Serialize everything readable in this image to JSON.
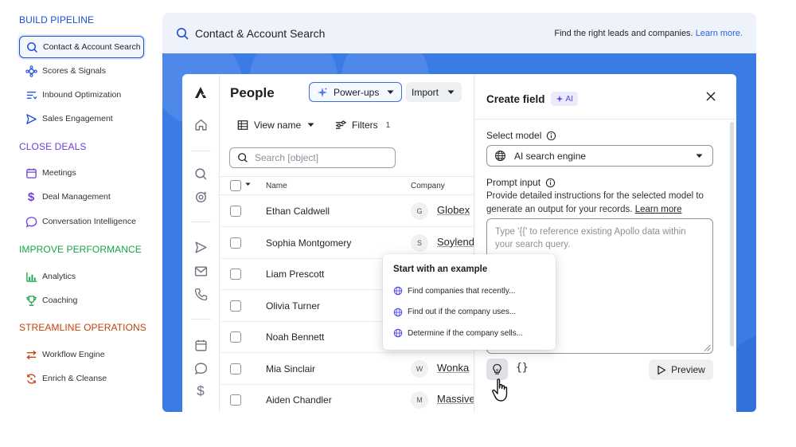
{
  "sidebar": {
    "sections": [
      {
        "title": "BUILD PIPELINE",
        "color": "#1d4ed8",
        "items": [
          {
            "label": "Contact & Account Search",
            "icon": "search-icon",
            "active": true
          },
          {
            "label": "Scores & Signals",
            "icon": "signals-icon"
          },
          {
            "label": "Inbound Optimization",
            "icon": "inbound-icon"
          },
          {
            "label": "Sales Engagement",
            "icon": "send-icon"
          }
        ]
      },
      {
        "title": "CLOSE DEALS",
        "color": "#6d3fd6",
        "items": [
          {
            "label": "Meetings",
            "icon": "calendar-icon"
          },
          {
            "label": "Deal Management",
            "icon": "dollar-icon"
          },
          {
            "label": "Conversation Intelligence",
            "icon": "chat-icon"
          }
        ]
      },
      {
        "title": "IMPROVE PERFORMANCE",
        "color": "#16a34a",
        "items": [
          {
            "label": "Analytics",
            "icon": "bar-chart-icon"
          },
          {
            "label": "Coaching",
            "icon": "trophy-icon"
          }
        ]
      },
      {
        "title": "STREAMLINE OPERATIONS",
        "color": "#c2410c",
        "items": [
          {
            "label": "Workflow Engine",
            "icon": "workflow-icon"
          },
          {
            "label": "Enrich & Cleanse",
            "icon": "refresh-icon"
          }
        ]
      }
    ]
  },
  "topbar": {
    "title": "Contact & Account Search",
    "tagline": "Find the right leads and companies.",
    "learn_more": "Learn more."
  },
  "people": {
    "title": "People",
    "powerups_label": "Power-ups",
    "import_label": "Import",
    "view_label": "View name",
    "filters_label": "Filters",
    "filters_count": "1",
    "search_placeholder": "Search [object]",
    "columns": {
      "name": "Name",
      "company": "Company"
    },
    "rows": [
      {
        "name": "Ethan Caldwell",
        "initial": "G",
        "company": "Globex"
      },
      {
        "name": "Sophia Montgomery",
        "initial": "S",
        "company": "Soylend"
      },
      {
        "name": "Liam Prescott",
        "initial": "",
        "company": ""
      },
      {
        "name": "Olivia Turner",
        "initial": "",
        "company": ""
      },
      {
        "name": "Noah Bennett",
        "initial": "",
        "company": ""
      },
      {
        "name": "Mia Sinclair",
        "initial": "W",
        "company": "Wonka"
      },
      {
        "name": "Aiden Chandler",
        "initial": "M",
        "company": "Massive"
      }
    ]
  },
  "panel": {
    "title": "Create field",
    "badge": "AI",
    "model_label": "Select model",
    "model_value": "AI search engine",
    "prompt_label": "Prompt input",
    "prompt_desc": "Provide detailed instructions for the selected model to generate an output for your records.",
    "prompt_learn_more": "Learn more",
    "prompt_placeholder": "Type '{{' to reference existing Apollo data within your search query.",
    "braces_label": "{}",
    "preview_label": "Preview"
  },
  "popover": {
    "title": "Start with an example",
    "items": [
      "Find companies that recently...",
      "Find out if the company uses...",
      "Determine if the company sells..."
    ]
  },
  "colors": {
    "accent": "#2563eb",
    "stage": "#3a7be6",
    "topbar_bg": "#eef2fb",
    "ai_purple": "#4f46e5"
  }
}
